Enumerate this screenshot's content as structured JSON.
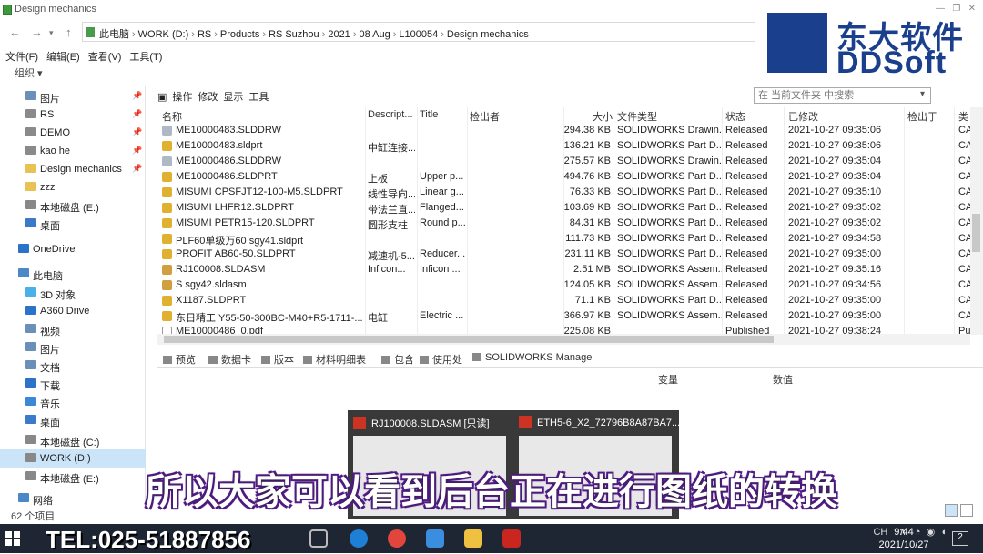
{
  "window": {
    "title": "Design mechanics"
  },
  "address": {
    "crumbs": [
      "此电脑",
      "WORK (D:)",
      "RS",
      "Products",
      "RS Suzhou",
      "2021",
      "08 Aug",
      "L100054",
      "Design mechanics"
    ]
  },
  "menu": [
    "文件(F)",
    "编辑(E)",
    "查看(V)",
    "工具(T)"
  ],
  "organize": "组织 ▾",
  "nav": {
    "items": [
      {
        "label": "图片",
        "pin": true
      },
      {
        "label": "RS",
        "pin": true
      },
      {
        "label": "DEMO",
        "pin": true
      },
      {
        "label": "kao he",
        "pin": true
      },
      {
        "label": "Design mechanics",
        "pin": true
      },
      {
        "label": "zzz",
        "pin": false
      },
      {
        "label": "本地磁盘 (E:)",
        "pin": false
      },
      {
        "label": "桌面",
        "pin": false
      },
      {
        "label": "OneDrive",
        "pin": false
      },
      {
        "label": "此电脑",
        "pin": false
      },
      {
        "label": "3D 对象",
        "pin": false
      },
      {
        "label": "A360 Drive",
        "pin": false
      },
      {
        "label": "视频",
        "pin": false
      },
      {
        "label": "图片",
        "pin": false
      },
      {
        "label": "文档",
        "pin": false
      },
      {
        "label": "下载",
        "pin": false
      },
      {
        "label": "音乐",
        "pin": false
      },
      {
        "label": "桌面",
        "pin": false
      },
      {
        "label": "本地磁盘 (C:)",
        "pin": false
      },
      {
        "label": "WORK (D:)",
        "pin": false
      },
      {
        "label": "本地磁盘 (E:)",
        "pin": false
      },
      {
        "label": "网络",
        "pin": false
      }
    ]
  },
  "toolbar": {
    "items": [
      "操作",
      "修改",
      "显示",
      "工具"
    ],
    "search_placeholder": "在 当前文件夹 中搜索"
  },
  "columns": [
    "名称",
    "Descript...",
    "Title",
    "检出者",
    "大小",
    "文件类型",
    "状态",
    "已修改",
    "检出于",
    "类"
  ],
  "files": [
    {
      "name": "ME10000483.SLDDRW",
      "desc": "",
      "title": "",
      "size": "294.38 KB",
      "type": "SOLIDWORKS Drawin...",
      "status": "Released",
      "modified": "2021-10-27 09:35:06",
      "cls": "CA"
    },
    {
      "name": "ME10000483.sldprt",
      "desc": "中缸连接...",
      "title": "",
      "size": "136.21 KB",
      "type": "SOLIDWORKS Part D...",
      "status": "Released",
      "modified": "2021-10-27 09:35:06",
      "cls": "CA"
    },
    {
      "name": "ME10000486.SLDDRW",
      "desc": "",
      "title": "",
      "size": "275.57 KB",
      "type": "SOLIDWORKS Drawin...",
      "status": "Released",
      "modified": "2021-10-27 09:35:04",
      "cls": "CA"
    },
    {
      "name": "ME10000486.SLDPRT",
      "desc": "上板",
      "title": "Upper p...",
      "size": "494.76 KB",
      "type": "SOLIDWORKS Part D...",
      "status": "Released",
      "modified": "2021-10-27 09:35:04",
      "cls": "CA"
    },
    {
      "name": "MISUMI CPSFJT12-100-M5.SLDPRT",
      "desc": "线性导向...",
      "title": "Linear g...",
      "size": "76.33 KB",
      "type": "SOLIDWORKS Part D...",
      "status": "Released",
      "modified": "2021-10-27 09:35:10",
      "cls": "CA"
    },
    {
      "name": "MISUMI LHFR12.SLDPRT",
      "desc": "带法兰直...",
      "title": "Flanged...",
      "size": "103.69 KB",
      "type": "SOLIDWORKS Part D...",
      "status": "Released",
      "modified": "2021-10-27 09:35:02",
      "cls": "CA"
    },
    {
      "name": "MISUMI PETR15-120.SLDPRT",
      "desc": "圆形支柱",
      "title": "Round p...",
      "size": "84.31 KB",
      "type": "SOLIDWORKS Part D...",
      "status": "Released",
      "modified": "2021-10-27 09:35:02",
      "cls": "CA"
    },
    {
      "name": "PLF60单级万60 sgy41.sldprt",
      "desc": "",
      "title": "",
      "size": "111.73 KB",
      "type": "SOLIDWORKS Part D...",
      "status": "Released",
      "modified": "2021-10-27 09:34:58",
      "cls": "CA"
    },
    {
      "name": "PROFIT AB60-50.SLDPRT",
      "desc": "减速机-5...",
      "title": "Reducer...",
      "size": "231.11 KB",
      "type": "SOLIDWORKS Part D...",
      "status": "Released",
      "modified": "2021-10-27 09:35:00",
      "cls": "CA"
    },
    {
      "name": "RJ100008.SLDASM",
      "desc": "Inficon...",
      "title": "Inficon ...",
      "size": "2.51 MB",
      "type": "SOLIDWORKS Assem...",
      "status": "Released",
      "modified": "2021-10-27 09:35:16",
      "cls": "CA"
    },
    {
      "name": "S sgy42.sldasm",
      "desc": "",
      "title": "",
      "size": "124.05 KB",
      "type": "SOLIDWORKS Assem...",
      "status": "Released",
      "modified": "2021-10-27 09:34:56",
      "cls": "CA"
    },
    {
      "name": "X1187.SLDPRT",
      "desc": "",
      "title": "",
      "size": "71.1 KB",
      "type": "SOLIDWORKS Part D...",
      "status": "Released",
      "modified": "2021-10-27 09:35:00",
      "cls": "CA"
    },
    {
      "name": "东日精工 Y55-50-300BC-M40+R5-1711-...",
      "desc": "电缸",
      "title": "Electric ...",
      "size": "366.97 KB",
      "type": "SOLIDWORKS Assem...",
      "status": "Released",
      "modified": "2021-10-27 09:35:00",
      "cls": "CA"
    },
    {
      "name": "ME10000486_0.pdf",
      "desc": "",
      "title": "",
      "size": "225.08 KB",
      "type": "",
      "status": "Published",
      "modified": "2021-10-27 09:38:24",
      "cls": "Pu"
    }
  ],
  "tabs": [
    "预览",
    "数据卡",
    "版本",
    "材料明细表",
    "包含",
    "使用处",
    "SOLIDWORKS Manage"
  ],
  "preview": {
    "col1": "变量",
    "col2": "数值"
  },
  "status": {
    "count": "62 个项目"
  },
  "logo": {
    "cn": "东大软件",
    "en": "DDSoft",
    "color": "#1a3f8c"
  },
  "taskthumbs": [
    {
      "title": "RJ100008.SLDASM [只读]"
    },
    {
      "title": "ETH5-6_X2_72796B8A87BA7..."
    }
  ],
  "caption": "所以大家可以看到后台正在进行图纸的转换",
  "taskbar": {
    "tel": "TEL:025-51887856",
    "ime": "CH",
    "time": "9:44",
    "date": "2021/10/27",
    "notif": "2"
  }
}
